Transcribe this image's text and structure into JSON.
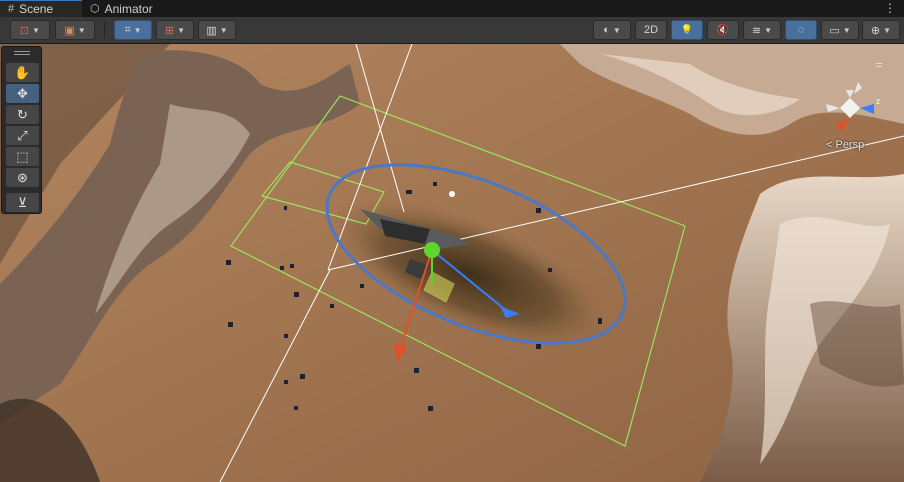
{
  "tabs": [
    {
      "label": "Scene",
      "icon": "grid-icon",
      "active": true
    },
    {
      "label": "Animator",
      "icon": "animator-icon",
      "active": false
    }
  ],
  "tab_menu_glyph": "⋮",
  "toolbar": {
    "left": [
      {
        "name": "draw-mode-button",
        "glyph": "⊡"
      },
      {
        "name": "shading-cube-button",
        "glyph": "▣"
      },
      {
        "name": "grid-snap-button",
        "glyph": "⌗"
      },
      {
        "name": "increment-snap-button",
        "glyph": "⊞"
      },
      {
        "name": "grid-visibility-button",
        "glyph": "▥"
      }
    ],
    "right": {
      "shading_glyph": "◐",
      "mode_2d": "2D",
      "lighting_glyph": "💡",
      "audio_glyph": "🔇",
      "effects_glyph": "≋",
      "hidden_glyph": "◌",
      "camera_glyph": "▭",
      "gizmos_glyph": "⊕"
    }
  },
  "tools_overlay": {
    "items": [
      {
        "name": "hand-tool",
        "glyph": "✋",
        "active": false
      },
      {
        "name": "move-tool",
        "glyph": "✥",
        "active": true
      },
      {
        "name": "rotate-tool",
        "glyph": "↻",
        "active": false
      },
      {
        "name": "scale-tool",
        "glyph": "⤢",
        "active": false
      },
      {
        "name": "rect-tool",
        "glyph": "⬚",
        "active": false
      },
      {
        "name": "transform-tool",
        "glyph": "⊛",
        "active": false
      },
      {
        "name": "custom-tool",
        "glyph": "⊻",
        "active": false
      }
    ]
  },
  "gizmo": {
    "projection_label": "< Persp",
    "axis_z_label": "z"
  },
  "colors": {
    "selection_outline": "#4a78c8",
    "bounds_green": "#9be35a",
    "axis_x_red": "#e1502a",
    "axis_y_green": "#5cd62c",
    "axis_z_blue": "#3a7dfc",
    "toolbar_active": "#4a6f9c"
  }
}
